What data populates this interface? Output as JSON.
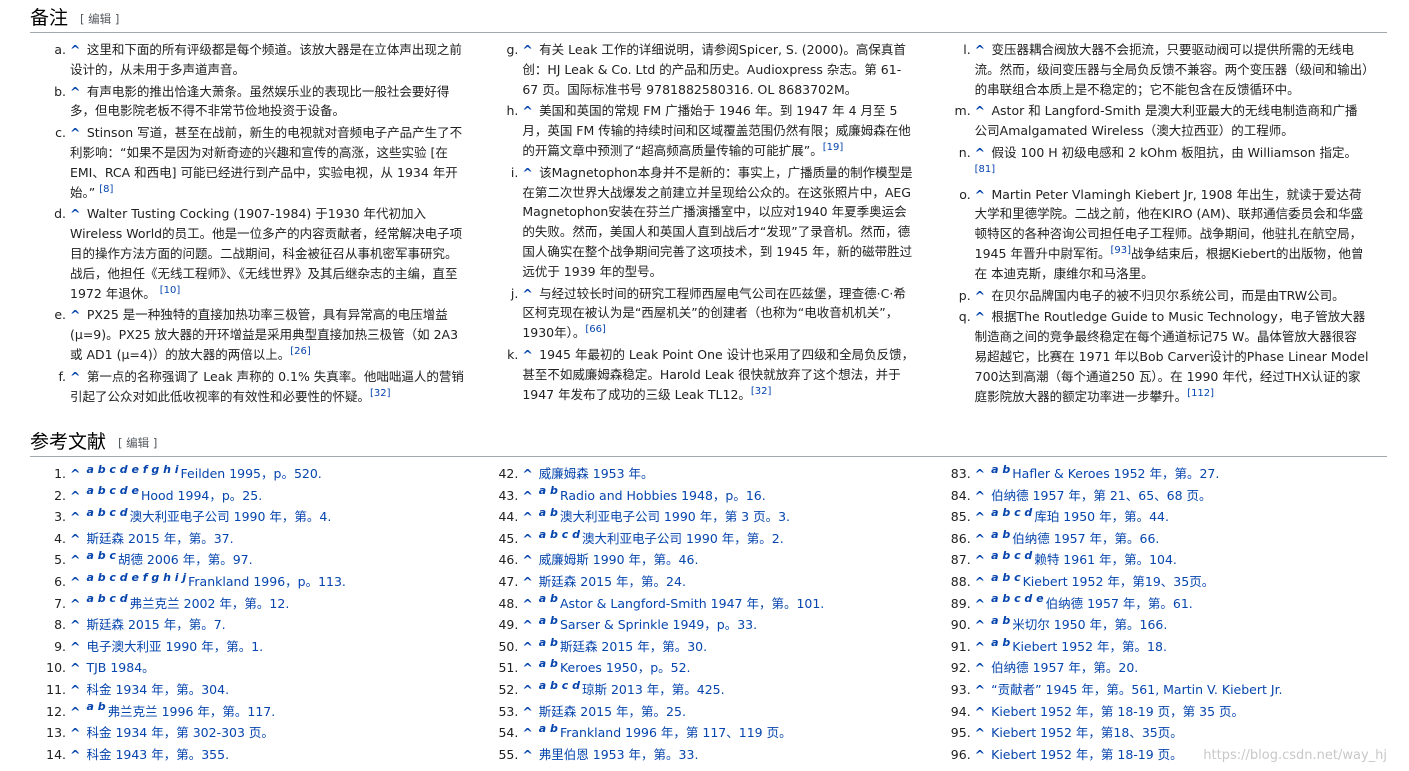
{
  "notes_section": {
    "title": "备注",
    "edit": "[ 编辑 ]"
  },
  "refs_section": {
    "title": "参考文献",
    "edit": "[ 编辑 ]"
  },
  "notes": [
    [
      "这里和下面的所有评级都是每个频道。该放大器是在立体声出现之前设计的，从未用于多声道声音。"
    ],
    [
      "有声电影的推出恰逢大萧条。虽然娱乐业的表现比一般社会要好得多，但电影院老板不得不非常节俭地投资于设备。"
    ],
    [
      "Stinson 写道，甚至在战前，新生的电视就对音频电子产品产生了不利影响：“如果不是因为对新奇迹的兴趣和宣传的高涨，这些实验 [在 EMI、RCA 和西电] 可能已经进行到产品中，实验电视，从 1934 年开始。” ",
      "[8]"
    ],
    [
      "Walter Tusting Cocking (1907-1984) 于1930 年代初加入Wireless World的员工。他是一位多产的内容贡献者，经常解决电子项目的操作方法方面的问题。二战期间，科金被征召从事机密军事研究。战后，他担任《无线工程师》、《无线世界》及其后继杂志的主编，直至 1972 年退休。 ",
      "[10]"
    ],
    [
      "PX25 是一种独特的直接加热功率三极管，具有异常高的电压增益 (μ=9)。PX25 放大器的开环增益是采用典型直接加热三极管（如 2A3 或 AD1 (μ=4)）的放大器的两倍以上。",
      "[26]"
    ],
    [
      "第一点的名称强调了 Leak 声称的 0.1% 失真率。他咄咄逼人的营销引起了公众对如此低收视率的有效性和必要性的怀疑。",
      "[32]"
    ],
    [
      "有关 Leak 工作的详细说明，请参阅Spicer, S. (2000)。高保真首创：HJ Leak & Co. Ltd 的产品和历史。Audioxpress 杂志。第 61-67 页。国际标准书号 9781882580316. OL 8683702M。"
    ],
    [
      "美国和英国的常规 FM 广播始于 1946 年。到 1947 年 4 月至 5 月，英国 FM 传输的持续时间和区域覆盖范围仍然有限；威廉姆森在他的开篇文章中预测了“超高频高质量传输的可能扩展”。",
      "[19]"
    ],
    [
      "该Magnetophon本身并不是新的：事实上，广播质量的制作模型是在第二次世界大战爆发之前建立并呈现给公众的。在这张照片中，AEG Magnetophon安装在芬兰广播演播室中，以应对1940 年夏季奥运会的失败。然而，美国人和英国人直到战后才“发现”了录音机。然而，德国人确实在整个战争期间完善了这项技术，到 1945 年，新的磁带胜过远优于 1939 年的型号。"
    ],
    [
      "与经过较长时间的研究工程师西屋电气公司在匹兹堡，理查德·C·希区柯克现在被认为是“西屋机关”的创建者（也称为“电收音机机关”，1930年）。",
      "[66]"
    ],
    [
      "1945 年最初的 Leak Point One 设计也采用了四级和全局负反馈，甚至不如威廉姆森稳定。Harold Leak 很快就放弃了这个想法，并于 1947 年发布了成功的三级 Leak TL12。",
      "[32]"
    ],
    [
      "变压器耦合阀放大器不会扼流，只要驱动阀可以提供所需的无线电流。然而，级间变压器与全局负反馈不兼容。两个变压器（级间和输出）的串联组合本质上是不稳定的；它不能包含在反馈循环中。"
    ],
    [
      "Astor 和 Langford-Smith 是澳大利亚最大的无线电制造商和广播公司Amalgamated Wireless（澳大拉西亚）的工程师。"
    ],
    [
      "假设 100 H 初级电感和 2 kOhm 板阻抗，由 Williamson 指定。",
      "[81]"
    ],
    [
      "Martin Peter Vlamingh Kiebert Jr, 1908 年出生，就读于爱达荷大学和里德学院。二战之前，他在KIRO (AM)、联邦通信委员会和华盛顿特区的各种咨询公司担任电子工程师。战争期间，他驻扎在航空局，1945 年晋升中尉军衔。",
      "[93]",
      "战争结束后，根据Kiebert的出版物，他曾在 本迪克斯，康维尔和马洛里。"
    ],
    [
      "在贝尔品牌国内电子的被不归贝尔系统公司，而是由TRW公司。"
    ],
    [
      "根据The Routledge Guide to Music Technology，电子管放大器制造商之间的竞争最终稳定在每个通道标记75 W。晶体管放大器很容易超越它，比赛在 1971 年以Bob Carver设计的Phase Linear Model 700达到高潮（每个通道250 瓦）。在 1990 年代，经过THX认证的家庭影院放大器的额定功率进一步攀升。",
      "[112]"
    ]
  ],
  "refs": [
    [
      "^",
      "a b c d e f g h i",
      "Feilden 1995，p。520."
    ],
    [
      "^",
      "a b c d e",
      "Hood 1994，p。25."
    ],
    [
      "^",
      "a b c d",
      "澳大利亚电子公司 1990 年，第。4."
    ],
    [
      "^",
      "",
      "斯廷森 2015 年，第。37."
    ],
    [
      "^",
      "a b c",
      "胡德 2006 年，第。97."
    ],
    [
      "^",
      "a b c d e f g h i j",
      "Frankland 1996，p。113."
    ],
    [
      "^",
      "a b c d",
      "弗兰克兰 2002 年，第。12."
    ],
    [
      "^",
      "",
      "斯廷森 2015 年，第。7."
    ],
    [
      "^",
      "",
      "电子澳大利亚 1990 年，第。1."
    ],
    [
      "^",
      "",
      "TJB 1984。"
    ],
    [
      "^",
      "",
      "科金 1934 年，第。304."
    ],
    [
      "^",
      "a b",
      "弗兰克兰 1996 年，第。117."
    ],
    [
      "^",
      "",
      "科金 1934 年，第 302-303 页。"
    ],
    [
      "^",
      "",
      "科金 1943 年，第。355."
    ],
    [
      "^",
      "",
      "威廉姆森 1953 年。"
    ],
    [
      "^",
      "a b",
      "Radio and Hobbies 1948，p。16."
    ],
    [
      "^",
      "a b",
      "澳大利亚电子公司 1990 年，第 3 页。3."
    ],
    [
      "^",
      "a b c d",
      "澳大利亚电子公司 1990 年，第。2."
    ],
    [
      "^",
      "",
      "威廉姆斯 1990 年，第。46."
    ],
    [
      "^",
      "",
      "斯廷森 2015 年，第。24."
    ],
    [
      "^",
      "a b",
      "Astor & Langford-Smith 1947 年，第。101."
    ],
    [
      "^",
      "a b",
      "Sarser & Sprinkle 1949，p。33."
    ],
    [
      "^",
      "a b",
      "斯廷森 2015 年，第。30."
    ],
    [
      "^",
      "a b",
      "Keroes 1950，p。52."
    ],
    [
      "^",
      "a b c d",
      "琼斯 2013 年，第。425."
    ],
    [
      "^",
      "",
      "斯廷森 2015 年，第。25."
    ],
    [
      "^",
      "a b",
      "Frankland 1996 年，第 117、119 页。"
    ],
    [
      "^",
      "",
      "弗里伯恩 1953 年，第。33."
    ],
    [
      "^",
      "a b",
      "Hafler & Keroes 1952 年，第。27."
    ],
    [
      "^",
      "",
      "伯纳德 1957 年，第 21、65、68 页。"
    ],
    [
      "^",
      "a b c d",
      "库珀 1950 年，第。44."
    ],
    [
      "^",
      "a b",
      "伯纳德 1957 年，第。66."
    ],
    [
      "^",
      "a b c d",
      "赖特 1961 年，第。104."
    ],
    [
      "^",
      "a b c",
      "Kiebert 1952 年，第19、35页。"
    ],
    [
      "^",
      "a b c d e",
      "伯纳德 1957 年，第。61."
    ],
    [
      "^",
      "a b",
      "米切尔 1950 年，第。166."
    ],
    [
      "^",
      "a b",
      "Kiebert 1952 年，第。18."
    ],
    [
      "^",
      "",
      "伯纳德 1957 年，第。20."
    ],
    [
      "^",
      "",
      "“贡献者” 1945 年，第。561, Martin V. Kiebert Jr."
    ],
    [
      "^",
      "",
      "Kiebert 1952 年，第 18-19 页，第 35 页。"
    ],
    [
      "^",
      "",
      "Kiebert 1952 年，第18、35页。"
    ],
    [
      "^",
      "",
      "Kiebert 1952 年，第 18-19 页。"
    ]
  ],
  "ref_starts": [
    1,
    42,
    83
  ],
  "watermark": "https://blog.csdn.net/way_hj"
}
